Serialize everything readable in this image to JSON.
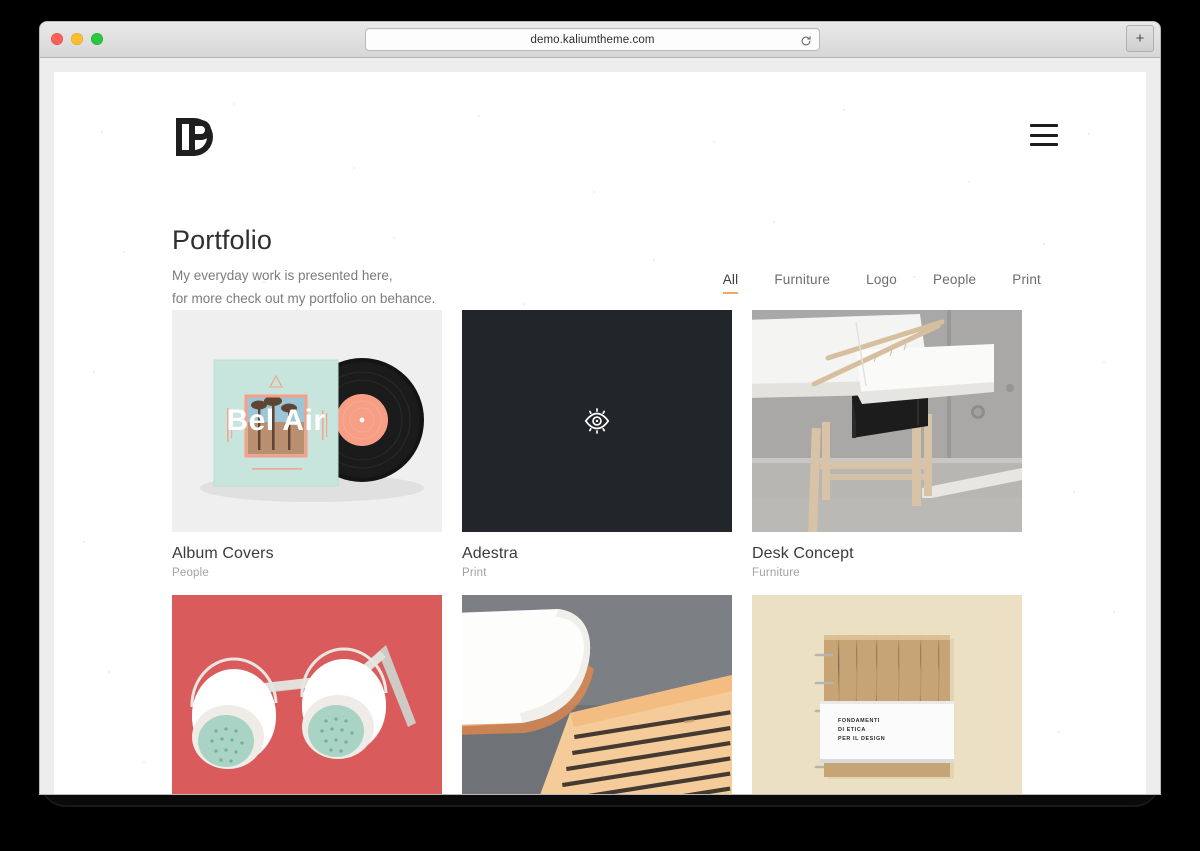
{
  "browser": {
    "url": "demo.kaliumtheme.com",
    "reload_icon": "reload-icon",
    "newtab_label": "+",
    "traffic_lights": [
      "close",
      "minimize",
      "maximize"
    ]
  },
  "site": {
    "logo_alt": "DP monogram logo",
    "menu_icon": "hamburger-menu-icon"
  },
  "intro": {
    "title": "Portfolio",
    "desc_line1": "My everyday work is presented here,",
    "desc_line2": "for more check out my portfolio on behance."
  },
  "filters": {
    "active": "All",
    "underline_color": "#f0a868",
    "items": [
      {
        "label": "All",
        "active": true
      },
      {
        "label": "Furniture",
        "active": false
      },
      {
        "label": "Logo",
        "active": false
      },
      {
        "label": "People",
        "active": false
      },
      {
        "label": "Print",
        "active": false
      }
    ]
  },
  "portfolio": {
    "items": [
      {
        "title": "Album Covers",
        "category": "People",
        "thumb": "vinyl-album-mockup",
        "artwork_text": "Bel Air",
        "state": "default"
      },
      {
        "title": "Adestra",
        "category": "Print",
        "thumb": "dark-hover-overlay",
        "overlay_icon": "eye-icon",
        "state": "hover"
      },
      {
        "title": "Desk Concept",
        "category": "Furniture",
        "thumb": "white-desk-photo",
        "state": "default"
      },
      {
        "title": "",
        "category": "",
        "thumb": "coral-shower-heads-photo",
        "state": "default"
      },
      {
        "title": "",
        "category": "",
        "thumb": "open-book-photo",
        "state": "default"
      },
      {
        "title": "",
        "category": "",
        "thumb": "wood-book-cover-photo",
        "cover_text_line1": "FONDAMENTI",
        "cover_text_line2": "DI ETICA",
        "cover_text_line3": "PER IL DESIGN",
        "state": "default"
      }
    ]
  }
}
